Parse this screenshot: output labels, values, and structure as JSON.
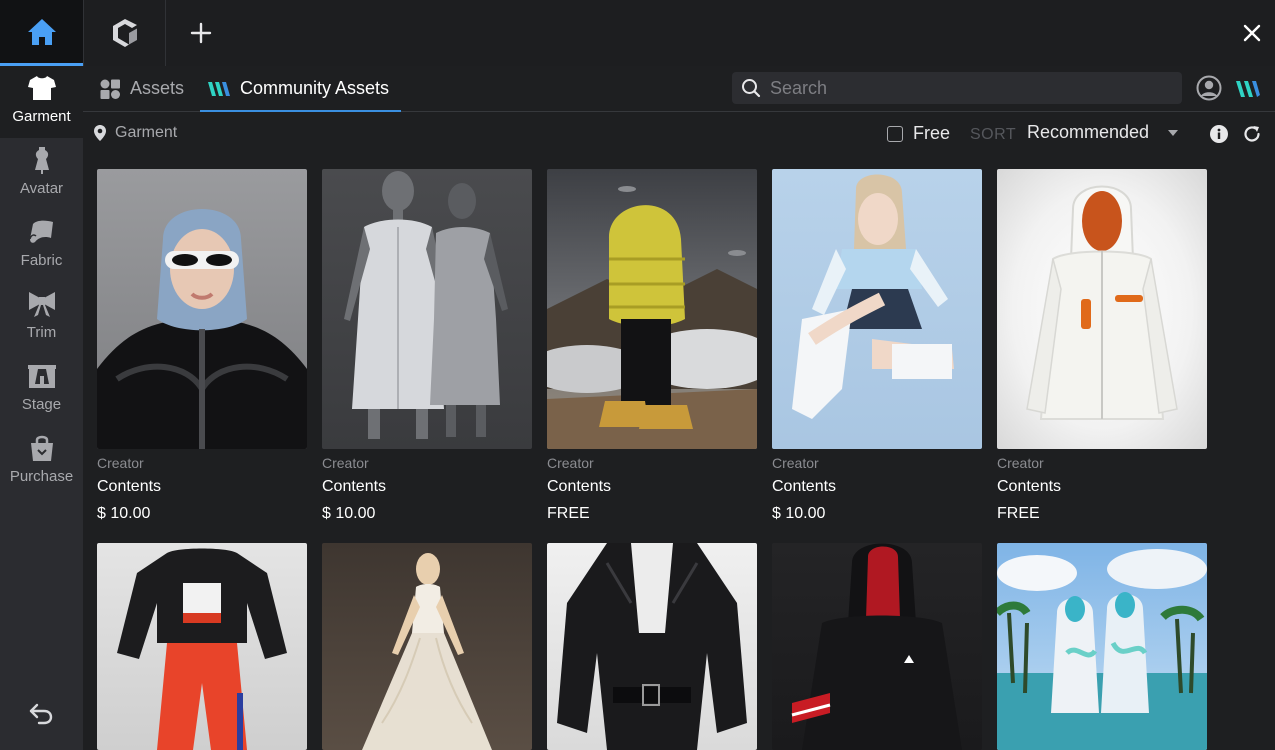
{
  "window": {
    "close_label": "×"
  },
  "sidebar": {
    "items": [
      {
        "label": "Garment",
        "icon": "tshirt-icon",
        "active": true
      },
      {
        "label": "Avatar",
        "icon": "mannequin-icon"
      },
      {
        "label": "Fabric",
        "icon": "fabric-icon"
      },
      {
        "label": "Trim",
        "icon": "bow-icon"
      },
      {
        "label": "Stage",
        "icon": "stage-icon"
      },
      {
        "label": "Purchase",
        "icon": "shopping-bag-icon"
      }
    ],
    "back_icon": "undo-icon"
  },
  "tabs": {
    "assets": "Assets",
    "community": "Community Assets"
  },
  "search": {
    "placeholder": "Search"
  },
  "breadcrumb": "Garment",
  "filter": {
    "free_label": "Free",
    "free_checked": false,
    "sort_label": "SORT",
    "sort_value": "Recommended"
  },
  "colors": {
    "accent": "#3a8fe0",
    "home_icon": "#4aa0f5",
    "brand_teal": "#2fd3c4",
    "background": "#1e1f21",
    "sidebar": "#2b2c30"
  },
  "cards": [
    {
      "creator": "Creator",
      "title": "Contents",
      "price": "$ 10.00"
    },
    {
      "creator": "Creator",
      "title": "Contents",
      "price": "$ 10.00"
    },
    {
      "creator": "Creator",
      "title": "Contents",
      "price": "FREE"
    },
    {
      "creator": "Creator",
      "title": "Contents",
      "price": "$ 10.00"
    },
    {
      "creator": "Creator",
      "title": "Contents",
      "price": "FREE"
    }
  ]
}
